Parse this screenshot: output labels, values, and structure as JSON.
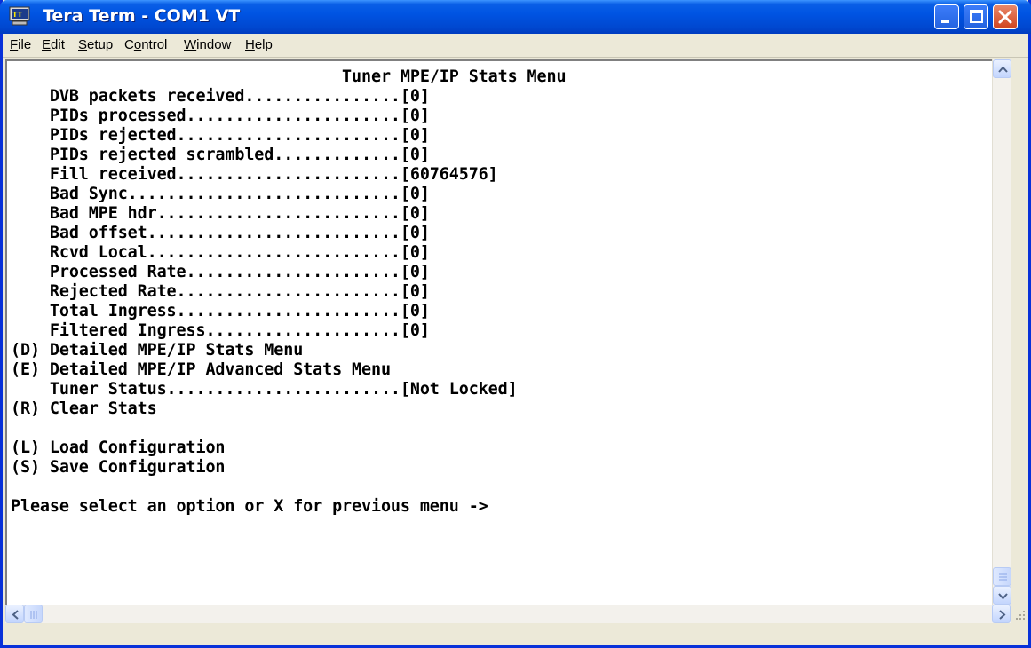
{
  "window": {
    "title": "Tera Term - COM1 VT",
    "colors": {
      "titlebar": "#0054e3",
      "close": "#d0441f",
      "terminal_bg": "#ffffff",
      "text": "#000000"
    },
    "icons": {
      "app": "tera-term-icon",
      "minimize": "minimize-icon",
      "maximize": "maximize-icon",
      "close": "close-icon"
    }
  },
  "menubar": {
    "items": [
      {
        "label": "File",
        "mnemonic": "F"
      },
      {
        "label": "Edit",
        "mnemonic": "E"
      },
      {
        "label": "Setup",
        "mnemonic": "S"
      },
      {
        "label": "Control",
        "mnemonic": "o"
      },
      {
        "label": "Window",
        "mnemonic": "W"
      },
      {
        "label": "Help",
        "mnemonic": "H"
      }
    ]
  },
  "terminal": {
    "lines": [
      "                                  Tuner MPE/IP Stats Menu",
      "    DVB packets received................[0]",
      "    PIDs processed......................[0]",
      "    PIDs rejected.......................[0]",
      "    PIDs rejected scrambled.............[0]",
      "    Fill received.......................[60764576]",
      "    Bad Sync............................[0]",
      "    Bad MPE hdr.........................[0]",
      "    Bad offset..........................[0]",
      "    Rcvd Local..........................[0]",
      "    Processed Rate......................[0]",
      "    Rejected Rate.......................[0]",
      "    Total Ingress.......................[0]",
      "    Filtered Ingress....................[0]",
      "(D) Detailed MPE/IP Stats Menu",
      "(E) Detailed MPE/IP Advanced Stats Menu",
      "    Tuner Status........................[Not Locked]",
      "(R) Clear Stats",
      "",
      "(L) Load Configuration",
      "(S) Save Configuration",
      "",
      "Please select an option or X for previous menu ->"
    ]
  },
  "scrollbars": {
    "vertical": {
      "up": "scroll-up-icon",
      "down": "scroll-down-icon",
      "position": 1.0
    },
    "horizontal": {
      "left": "scroll-left-icon",
      "right": "scroll-right-icon",
      "position": 0.0
    }
  }
}
